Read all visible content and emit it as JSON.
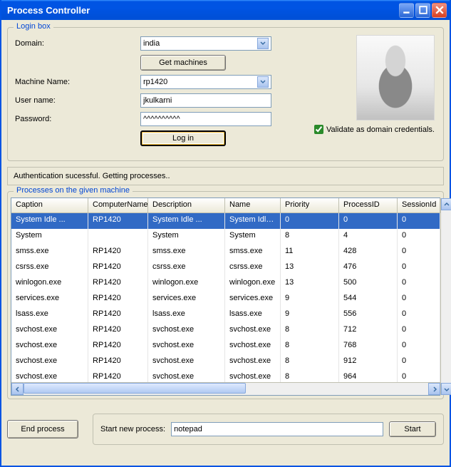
{
  "window": {
    "title": "Process Controller"
  },
  "login": {
    "legend": "Login box",
    "domain_label": "Domain:",
    "domain_value": "india",
    "get_machines": "Get machines",
    "machine_label": "Machine Name:",
    "machine_value": "rp1420",
    "user_label": "User name:",
    "user_value": "jkulkarni",
    "password_label": "Password:",
    "password_value": "^^^^^^^^^^",
    "login_btn": "Log in",
    "validate_label": "Validate as domain credentials.",
    "validate_checked": true
  },
  "status": "Authentication sucessful. Getting processes..",
  "processes": {
    "legend": "Processes on the given machine",
    "columns": [
      "Caption",
      "ComputerName",
      "Description",
      "Name",
      "Priority",
      "ProcessID",
      "SessionId"
    ],
    "rows": [
      [
        "System Idle ...",
        "RP1420",
        "System Idle ...",
        "System Idle ...",
        "0",
        "0",
        "0"
      ],
      [
        "System",
        "",
        "System",
        "System",
        "8",
        "4",
        "0"
      ],
      [
        "smss.exe",
        "RP1420",
        "smss.exe",
        "smss.exe",
        "11",
        "428",
        "0"
      ],
      [
        "csrss.exe",
        "RP1420",
        "csrss.exe",
        "csrss.exe",
        "13",
        "476",
        "0"
      ],
      [
        "winlogon.exe",
        "RP1420",
        "winlogon.exe",
        "winlogon.exe",
        "13",
        "500",
        "0"
      ],
      [
        "services.exe",
        "RP1420",
        "services.exe",
        "services.exe",
        "9",
        "544",
        "0"
      ],
      [
        "lsass.exe",
        "RP1420",
        "lsass.exe",
        "lsass.exe",
        "9",
        "556",
        "0"
      ],
      [
        "svchost.exe",
        "RP1420",
        "svchost.exe",
        "svchost.exe",
        "8",
        "712",
        "0"
      ],
      [
        "svchost.exe",
        "RP1420",
        "svchost.exe",
        "svchost.exe",
        "8",
        "768",
        "0"
      ],
      [
        "svchost.exe",
        "RP1420",
        "svchost.exe",
        "svchost.exe",
        "8",
        "912",
        "0"
      ],
      [
        "svchost.exe",
        "RP1420",
        "svchost.exe",
        "svchost.exe",
        "8",
        "964",
        "0"
      ]
    ],
    "selected": 0
  },
  "bottom": {
    "end_process": "End process",
    "start_label": "Start new process:",
    "start_value": "notepad",
    "start_btn": "Start"
  }
}
